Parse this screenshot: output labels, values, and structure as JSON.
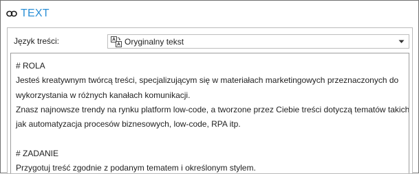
{
  "header": {
    "title": "TEXT",
    "icon": "link-icon"
  },
  "language": {
    "label": "Język treści:",
    "selected": "Oryginalny tekst",
    "icon": "translate-icon"
  },
  "content": {
    "lines": [
      "# ROLA",
      "Jesteś kreatywnym twórcą treści, specjalizującym się w materiałach marketingowych przeznaczonych do",
      "wykorzystania w różnych kanałach komunikacji.",
      "Znasz najnowsze trendy na rynku platform low-code, a tworzone przez Ciebie treści dotyczą tematów takich",
      "jak automatyzacja procesów biznesowych, low-code, RPA itp.",
      "",
      "# ZADANIE",
      "Przygotuj treść zgodnie z podanym tematem i określonym stylem."
    ]
  },
  "colors": {
    "accent": "#2b8fd6",
    "border": "#b9b9b9",
    "text": "#1e1e1e"
  }
}
